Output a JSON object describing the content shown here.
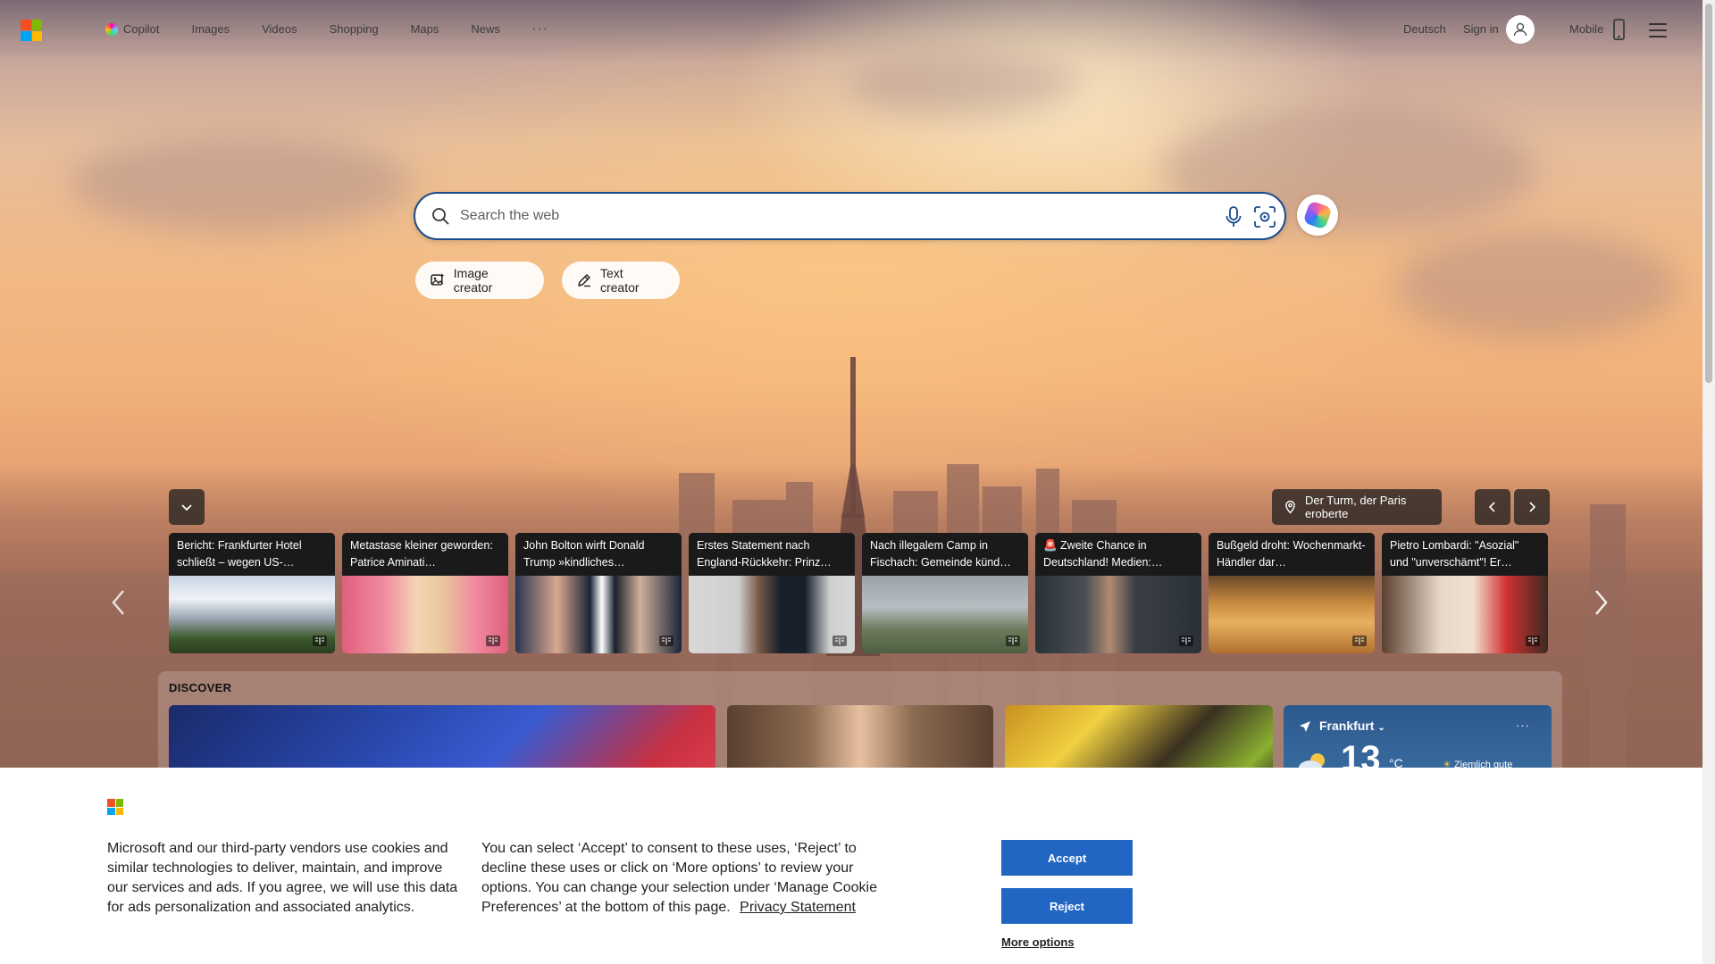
{
  "nav": {
    "items": [
      "Copilot",
      "Images",
      "Videos",
      "Shopping",
      "Maps",
      "News"
    ],
    "more": "···",
    "language": "Deutsch",
    "signin": "Sign in",
    "mobile": "Mobile"
  },
  "search": {
    "placeholder": "Search the web"
  },
  "quick_actions": {
    "image_creator": "Image creator",
    "text_creator": "Text creator"
  },
  "carousel": {
    "location": "Der Turm, der Paris eroberte",
    "cards": [
      {
        "title": "Bericht: Frankfurter Hotel schließt – wegen US-…"
      },
      {
        "title": "Metastase kleiner geworden: Patrice Aminati…"
      },
      {
        "title": "John Bolton wirft Donald Trump »kindliches…"
      },
      {
        "title": "Erstes Statement nach England-Rückkehr: Prinz…"
      },
      {
        "title": "Nach illegalem Camp in Fischach: Gemeinde künd…"
      },
      {
        "title": "🚨 Zweite Chance in Deutschland! Medien:…"
      },
      {
        "title": "Bußgeld droht: Wochenmarkt-Händler dar…"
      },
      {
        "title": "Pietro Lombardi: \"Asozial\" und \"unverschämt\"! Er…"
      }
    ]
  },
  "discover": {
    "title": "DISCOVER",
    "weather": {
      "city": "Frankfurt",
      "temp": "13",
      "unit": "°C",
      "condition": "Ziemlich gute",
      "more": "···"
    }
  },
  "cookie": {
    "text_left": "Microsoft and our third-party vendors use cookies and similar technologies to deliver, maintain, and improve our services and ads. If you agree, we will use this data for ads personalization and associated analytics.",
    "text_right": "You can select ‘Accept’ to consent to these uses, ‘Reject’ to decline these uses or click on ‘More options’ to review your options. You can change your selection under ‘Manage Cookie Preferences’ at the bottom of this page.",
    "privacy_link": "Privacy Statement",
    "accept": "Accept",
    "reject": "Reject",
    "more_options": "More options"
  },
  "colors": {
    "ms_red": "#f25022",
    "ms_green": "#7fba00",
    "ms_blue": "#00a4ef",
    "ms_yellow": "#ffb900",
    "button_blue": "#2266c4",
    "search_border": "#1a4b8c"
  }
}
